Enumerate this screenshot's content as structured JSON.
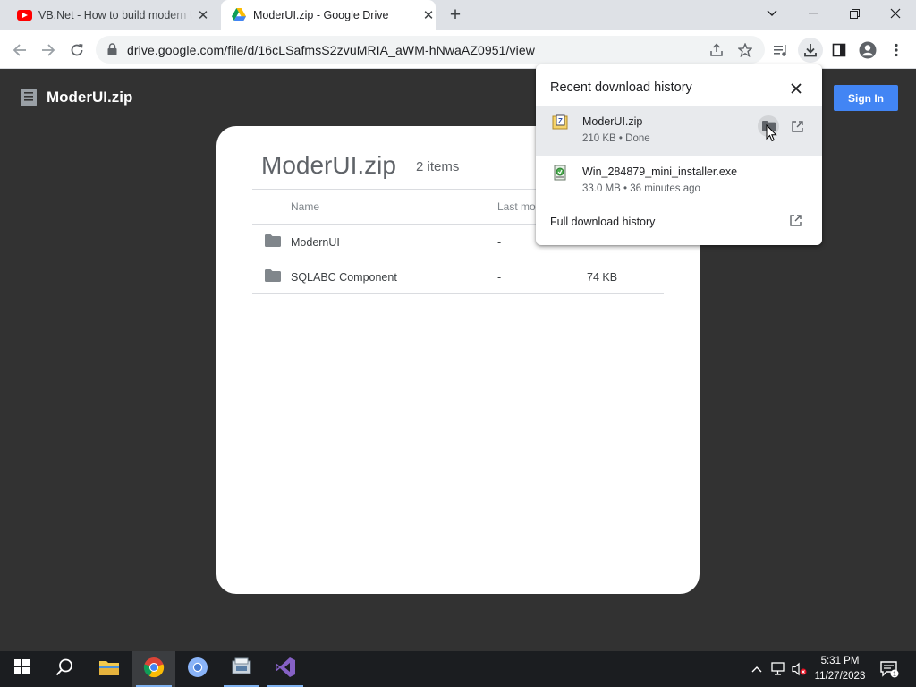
{
  "browser": {
    "tabs": [
      {
        "title": "VB.Net - How to build modern UI",
        "favicon": "youtube-icon",
        "active": false
      },
      {
        "title": "ModerUI.zip - Google Drive",
        "favicon": "google-drive-icon",
        "active": true
      }
    ],
    "url": "drive.google.com/file/d/16cLSafmsS2zvuMRIA_aWM-hNwaAZ0951/view"
  },
  "drive": {
    "logo_title": "ModerUI.zip",
    "sign_in_label": "Sign In",
    "panel": {
      "title": "ModerUI.zip",
      "count": "2 items",
      "columns": {
        "name": "Name",
        "modified": "Last mo"
      },
      "rows": [
        {
          "name": "ModernUI",
          "modified": "-",
          "size": ""
        },
        {
          "name": "SQLABC Component",
          "modified": "-",
          "size": "74 KB"
        }
      ]
    }
  },
  "downloads": {
    "title": "Recent download history",
    "items": [
      {
        "name": "ModerUI.zip",
        "meta": "210 KB • Done",
        "icon": "zip-file-icon"
      },
      {
        "name": "Win_284879_mini_installer.exe",
        "meta": "33.0 MB • 36 minutes ago",
        "icon": "installer-file-icon"
      }
    ],
    "full_history": "Full download history"
  },
  "taskbar": {
    "time": "5:31 PM",
    "date": "11/27/2023",
    "notification_count": "1"
  },
  "colors": {
    "page_background": "#323232",
    "sign_in_button": "#4285f4",
    "tab_strip": "#dee1e6",
    "taskbar": "#1b1d20"
  }
}
